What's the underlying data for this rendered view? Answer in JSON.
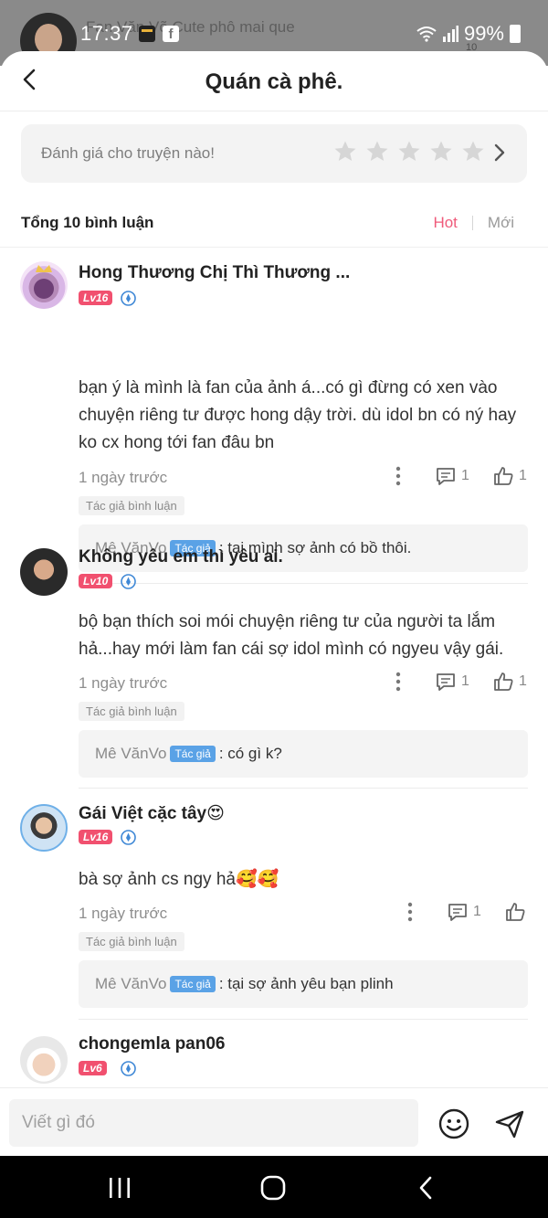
{
  "status_bar": {
    "time": "17:37",
    "battery": "99%",
    "notification_text": "Fan Văn Võ Cute phô mai que",
    "small_count": "10"
  },
  "header": {
    "title": "Quán cà phê."
  },
  "rating": {
    "prompt": "Đánh giá cho truyện nào!",
    "star_count": 5
  },
  "comments_header": {
    "total": "Tổng 10 bình luận",
    "sort_hot": "Hot",
    "sort_new": "Mới"
  },
  "comments": [
    {
      "username": "Hong Thương Chị Thì Thương ...",
      "level": "Lv16",
      "text": "bạn ý là mình là fan của ảnh á...có gì đừng có xen vào chuyện riêng tư được hong dậy trời. dù idol bn có ný hay ko cx hong tới fan đâu bn",
      "time": "1 ngày trước",
      "reply_count": "1",
      "like_count": "1",
      "author_tag": "Tác giả bình luận",
      "reply": {
        "name": "Mê VănVo",
        "tag": "Tác giả",
        "text": ": tại mình sợ ảnh có bồ thôi."
      }
    },
    {
      "username": "Không yêu em thì yêu ai.",
      "level": "Lv10",
      "text": "bộ bạn thích soi mói chuyện riêng tư của người ta lắm hả...hay mới làm fan cái sợ idol mình có ngyeu vậy gái.",
      "time": "1 ngày trước",
      "reply_count": "1",
      "like_count": "1",
      "author_tag": "Tác giả bình luận",
      "reply": {
        "name": "Mê VănVo",
        "tag": "Tác giả",
        "text": ": có gì k?"
      }
    },
    {
      "username": "Gái Việt cặc tây😍",
      "level": "Lv16",
      "text": "bà sợ ảnh cs ngy hả🥰🥰",
      "time": "1 ngày trước",
      "reply_count": "1",
      "like_count": "",
      "author_tag": "Tác giả bình luận",
      "reply": {
        "name": "Mê VănVo",
        "tag": "Tác giả",
        "text": ": tại sợ ảnh yêu bạn plinh"
      }
    },
    {
      "username": "chongemla pan06",
      "level": "Lv6"
    }
  ],
  "input": {
    "placeholder": "Viết gì đó"
  },
  "colors": {
    "accent_pink": "#ef5a7a",
    "level_badge": "#f1506f",
    "author_badge": "#5aa2e6"
  }
}
